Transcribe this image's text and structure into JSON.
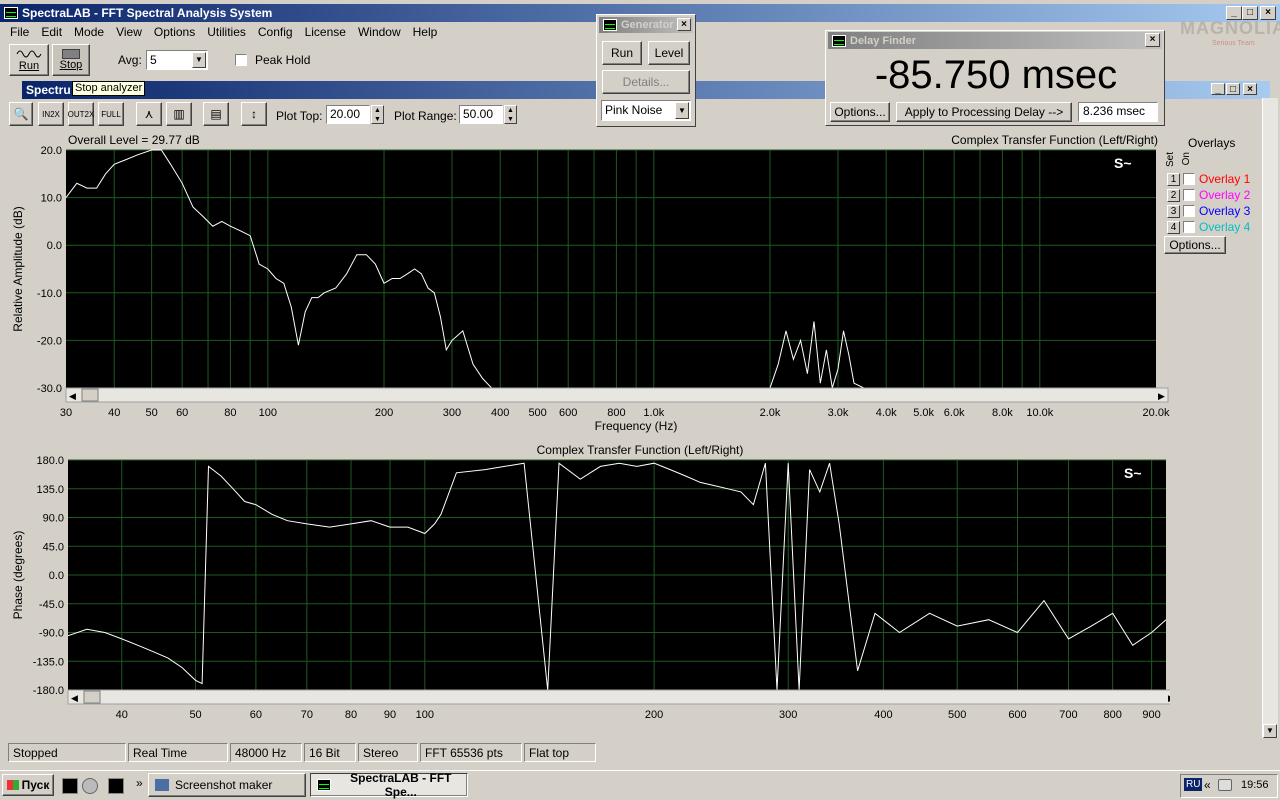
{
  "app": {
    "title": "SpectraLAB - FFT Spectral Analysis System",
    "menu": [
      "File",
      "Edit",
      "Mode",
      "View",
      "Options",
      "Utilities",
      "Config",
      "License",
      "Window",
      "Help"
    ]
  },
  "toolbar": {
    "run_label": "Run",
    "stop_label": "Stop",
    "avg_label": "Avg:",
    "avg_value": "5",
    "peak_hold_label": "Peak Hold",
    "tooltip": "Stop analyzer"
  },
  "inner_window": {
    "title_short": "Spectru",
    "plot_top_label": "Plot Top:",
    "plot_top_value": "20.00",
    "plot_range_label": "Plot Range:",
    "plot_range_value": "50.00"
  },
  "generator": {
    "title": "Generator",
    "run_label": "Run",
    "level_label": "Level",
    "details_label": "Details...",
    "noise_value": "Pink Noise"
  },
  "delay_finder": {
    "title": "Delay Finder",
    "readout": "-85.750 msec",
    "options_label": "Options...",
    "apply_label": "Apply to Processing Delay -->",
    "delay_value": "8.236 msec"
  },
  "watermark": {
    "brand": "MAGNOLIA",
    "sub": "Serious Team"
  },
  "overlays": {
    "title": "Overlays",
    "set_label": "Set",
    "on_label": "On",
    "items": [
      {
        "num": "1",
        "label": "Overlay 1",
        "color": "#ff0000"
      },
      {
        "num": "2",
        "label": "Overlay 2",
        "color": "#ff00ff"
      },
      {
        "num": "3",
        "label": "Overlay 3",
        "color": "#0000ff"
      },
      {
        "num": "4",
        "label": "Overlay 4",
        "color": "#00c0c0"
      }
    ],
    "options_label": "Options..."
  },
  "chart_data": [
    {
      "type": "line",
      "title": "Complex Transfer Function (Left/Right)",
      "annotation": "Overall Level = 29.77 dB",
      "xlabel": "Frequency (Hz)",
      "ylabel": "Relative Amplitude (dB)",
      "xscale": "log",
      "xlim": [
        30,
        20000
      ],
      "ylim": [
        -30,
        20
      ],
      "xticks": [
        "30",
        "40",
        "50",
        "60",
        "80",
        "100",
        "200",
        "300",
        "400",
        "500",
        "600",
        "800",
        "1.0k",
        "2.0k",
        "3.0k",
        "4.0k",
        "5.0k",
        "6.0k",
        "8.0k",
        "10.0k",
        "20.0k"
      ],
      "xtick_values": [
        30,
        40,
        50,
        60,
        80,
        100,
        200,
        300,
        400,
        500,
        600,
        800,
        1000,
        2000,
        3000,
        4000,
        5000,
        6000,
        8000,
        10000,
        20000
      ],
      "yticks": [
        "20.0",
        "10.0",
        "0.0",
        "-10.0",
        "-20.0",
        "-30.0"
      ],
      "ytick_values": [
        20,
        10,
        0,
        -10,
        -20,
        -30
      ],
      "grid": true,
      "line_color": "#ffffff",
      "x": [
        30,
        32,
        34,
        36,
        38,
        40,
        43,
        46,
        50,
        53,
        56,
        60,
        64,
        68,
        72,
        76,
        80,
        85,
        90,
        95,
        100,
        105,
        110,
        115,
        120,
        125,
        130,
        135,
        140,
        150,
        160,
        170,
        180,
        190,
        200,
        210,
        220,
        230,
        240,
        250,
        260,
        270,
        280,
        290,
        300,
        320,
        340,
        360,
        380,
        400,
        420,
        450,
        500,
        600,
        800,
        1000,
        1500,
        2000,
        2100,
        2200,
        2300,
        2400,
        2500,
        2600,
        2700,
        2800,
        2900,
        3000,
        3100,
        3200,
        3300,
        3500,
        4000
      ],
      "y": [
        10,
        13,
        12,
        12,
        15,
        17,
        18,
        19,
        20,
        20,
        17,
        13,
        8,
        6,
        4,
        5,
        4,
        3,
        2,
        -4,
        -5,
        -7,
        -8,
        -13,
        -21,
        -14,
        -11,
        -11,
        -10,
        -9,
        -6,
        -2,
        -2,
        -4,
        -8,
        -7,
        -7,
        -6,
        -5,
        -6,
        -9,
        -10,
        -15,
        -22,
        -20,
        -18,
        -25,
        -28,
        -30,
        -30,
        -30,
        -30,
        -30,
        -30,
        -30,
        -30,
        -30,
        -30,
        -25,
        -18,
        -24,
        -20,
        -27,
        -16,
        -29,
        -22,
        -30,
        -26,
        -18,
        -23,
        -29,
        -30,
        -30
      ]
    },
    {
      "type": "line",
      "title": "Complex Transfer Function (Left/Right)",
      "xlabel": "",
      "ylabel": "Phase (degrees)",
      "xscale": "log",
      "xlim": [
        34,
        940
      ],
      "ylim": [
        -180,
        180
      ],
      "xticks": [
        "40",
        "50",
        "60",
        "70",
        "80",
        "90",
        "100",
        "200",
        "300",
        "400",
        "500",
        "600",
        "700",
        "800",
        "900"
      ],
      "xtick_values": [
        40,
        50,
        60,
        70,
        80,
        90,
        100,
        200,
        300,
        400,
        500,
        600,
        700,
        800,
        900
      ],
      "yticks": [
        "180.0",
        "135.0",
        "90.0",
        "45.0",
        "0.0",
        "-45.0",
        "-90.0",
        "-135.0",
        "-180.0"
      ],
      "ytick_values": [
        180,
        135,
        90,
        45,
        0,
        -45,
        -90,
        -135,
        -180
      ],
      "grid": true,
      "line_color": "#ffffff",
      "x": [
        34,
        36,
        38,
        40,
        42,
        44,
        46,
        48,
        50,
        51,
        52,
        54,
        56,
        58,
        60,
        63,
        66,
        70,
        75,
        80,
        85,
        90,
        95,
        100,
        103,
        105,
        110,
        120,
        135,
        145,
        150,
        160,
        170,
        180,
        190,
        200,
        210,
        220,
        230,
        240,
        250,
        260,
        270,
        280,
        290,
        300,
        310,
        320,
        330,
        340,
        350,
        370,
        390,
        420,
        460,
        500,
        550,
        600,
        650,
        700,
        750,
        800,
        850,
        900,
        940
      ],
      "y": [
        -95,
        -85,
        -90,
        -100,
        -110,
        -120,
        -130,
        -145,
        -165,
        -170,
        170,
        155,
        135,
        115,
        110,
        95,
        85,
        80,
        75,
        80,
        85,
        75,
        75,
        65,
        80,
        95,
        160,
        165,
        175,
        -180,
        175,
        150,
        170,
        175,
        170,
        175,
        165,
        155,
        145,
        140,
        135,
        130,
        110,
        175,
        -180,
        175,
        -180,
        165,
        130,
        175,
        80,
        -150,
        -60,
        -90,
        -60,
        -80,
        -70,
        -90,
        -40,
        -100,
        -80,
        -60,
        -110,
        -90,
        -70
      ]
    }
  ],
  "status": {
    "state": "Stopped",
    "mode": "Real Time",
    "rate": "48000 Hz",
    "bits": "16 Bit",
    "channels": "Stereo",
    "fft": "FFT 65536 pts",
    "window": "Flat top"
  },
  "taskbar": {
    "start_label": "Пуск",
    "task1": "Screenshot maker",
    "task2": "SpectraLAB - FFT Spe...",
    "lang": "RU",
    "clock": "19:56"
  }
}
